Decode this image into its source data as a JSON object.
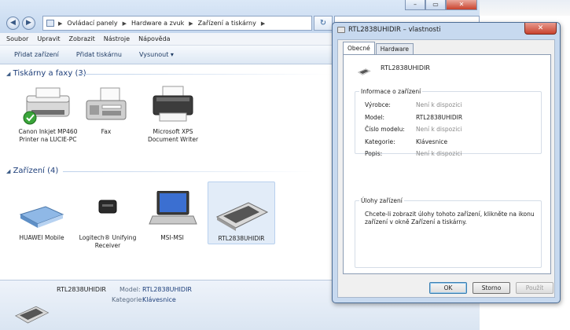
{
  "explorer": {
    "breadcrumb": [
      "Ovládací panely",
      "Hardware a zvuk",
      "Zařízení a tiskárny"
    ],
    "menu": [
      "Soubor",
      "Upravit",
      "Zobrazit",
      "Nástroje",
      "Nápověda"
    ],
    "commands": [
      "Přidat zařízení",
      "Přidat tiskárnu",
      "Vysunout ▾"
    ],
    "groups": [
      {
        "title": "Tiskárny a faxy (3)",
        "items": [
          {
            "label": "Canon Inkjet MP460 Printer na LUCIE-PC",
            "icon": "printer-default-icon"
          },
          {
            "label": "Fax",
            "icon": "fax-icon"
          },
          {
            "label": "Microsoft XPS Document Writer",
            "icon": "xps-printer-icon"
          }
        ]
      },
      {
        "title": "Zařízení (4)",
        "items": [
          {
            "label": "HUAWEI Mobile",
            "icon": "modem-icon"
          },
          {
            "label": "Logitech® Unifying Receiver",
            "icon": "usb-receiver-icon"
          },
          {
            "label": "MSI-MSI",
            "icon": "laptop-icon"
          },
          {
            "label": "RTL2838UHIDIR",
            "icon": "keyboard-icon"
          }
        ]
      }
    ],
    "details": {
      "name": "RTL2838UHIDIR",
      "model_label": "Model:",
      "model_value": "RTL2838UHIDIR",
      "category_label": "Kategorie:",
      "category_value": "Klávesnice"
    }
  },
  "dialog": {
    "title": "RTL2838UHIDIR – vlastnosti",
    "close": "✕",
    "tabs": [
      "Obecné",
      "Hardware"
    ],
    "device_name": "RTL2838UHIDIR",
    "info_legend": "Informace o zařízení",
    "info": [
      {
        "label": "Výrobce:",
        "value": "Není k dispozici",
        "na": true
      },
      {
        "label": "Model:",
        "value": "RTL2838UHIDIR",
        "na": false
      },
      {
        "label": "Číslo modelu:",
        "value": "Není k dispozici",
        "na": true
      },
      {
        "label": "Kategorie:",
        "value": "Klávesnice",
        "na": false
      },
      {
        "label": "Popis:",
        "value": "Není k dispozici",
        "na": true
      }
    ],
    "tasks_legend": "Úlohy zařízení",
    "tasks_text": "Chcete-li zobrazit úlohy tohoto zařízení, klikněte na ikonu zařízení v okně Zařízení a tiskárny.",
    "buttons": {
      "ok": "OK",
      "cancel": "Storno",
      "apply": "Použít"
    }
  },
  "colors": {
    "accent": "#1e3f7a",
    "selection": "#e2ecf8",
    "close": "#c8422d"
  }
}
